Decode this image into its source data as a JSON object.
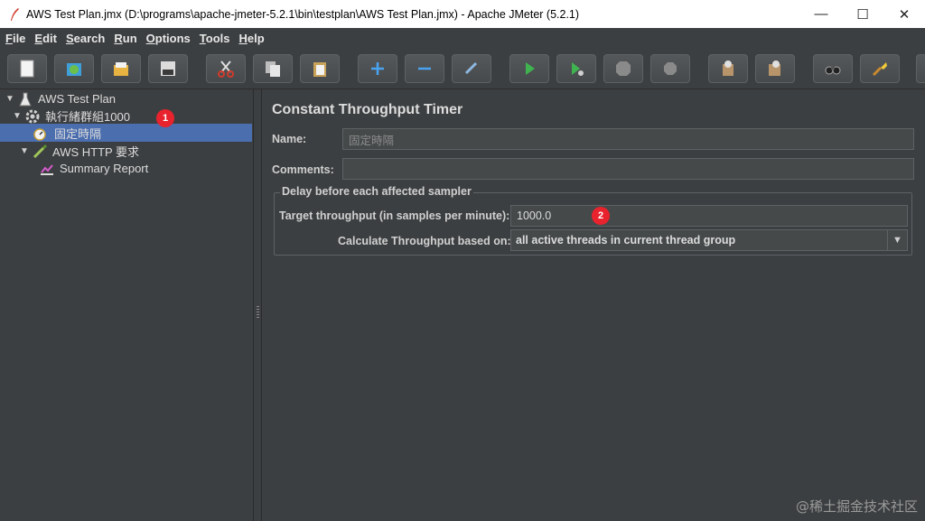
{
  "window": {
    "title": "AWS Test Plan.jmx (D:\\programs\\apache-jmeter-5.2.1\\bin\\testplan\\AWS Test Plan.jmx) - Apache JMeter (5.2.1)",
    "minimize": "—",
    "maximize": "☐",
    "close": "✕"
  },
  "menu": [
    {
      "u": "F",
      "rest": "ile"
    },
    {
      "u": "E",
      "rest": "dit"
    },
    {
      "u": "S",
      "rest": "earch"
    },
    {
      "u": "R",
      "rest": "un"
    },
    {
      "u": "O",
      "rest": "ptions"
    },
    {
      "u": "T",
      "rest": "ools"
    },
    {
      "u": "H",
      "rest": "elp"
    }
  ],
  "toolbar_icons": [
    "new-icon",
    "templates-icon",
    "open-icon",
    "save-icon",
    "cut-icon",
    "copy-icon",
    "paste-icon",
    "expand-icon",
    "collapse-icon",
    "toggle-icon",
    "start-icon",
    "start-no-pauses-icon",
    "stop-icon",
    "shutdown-icon",
    "clear-icon",
    "clear-all-icon",
    "search-icon",
    "reset-search-icon",
    "function-helper-icon"
  ],
  "tree": {
    "test_plan": "AWS Test Plan",
    "thread_group": "執行緒群組1000",
    "timer": "固定時隔",
    "http_request": "AWS HTTP 要求",
    "summary_report": "Summary Report",
    "badge_1": "1"
  },
  "panel": {
    "heading": "Constant Throughput Timer",
    "name_label": "Name:",
    "name_value": "固定時隔",
    "comments_label": "Comments:",
    "comments_value": "",
    "group_title": "Delay before each affected sampler",
    "target_label": "Target throughput (in samples per minute):",
    "target_value": "1000.0",
    "badge_2": "2",
    "calc_label": "Calculate Throughput based on:",
    "calc_value": "all active threads in current thread group"
  },
  "watermark": "@稀土掘金技术社区",
  "colors": {
    "selection": "#4b6eaf",
    "background": "#3c3f41",
    "badge": "#e8232d"
  }
}
